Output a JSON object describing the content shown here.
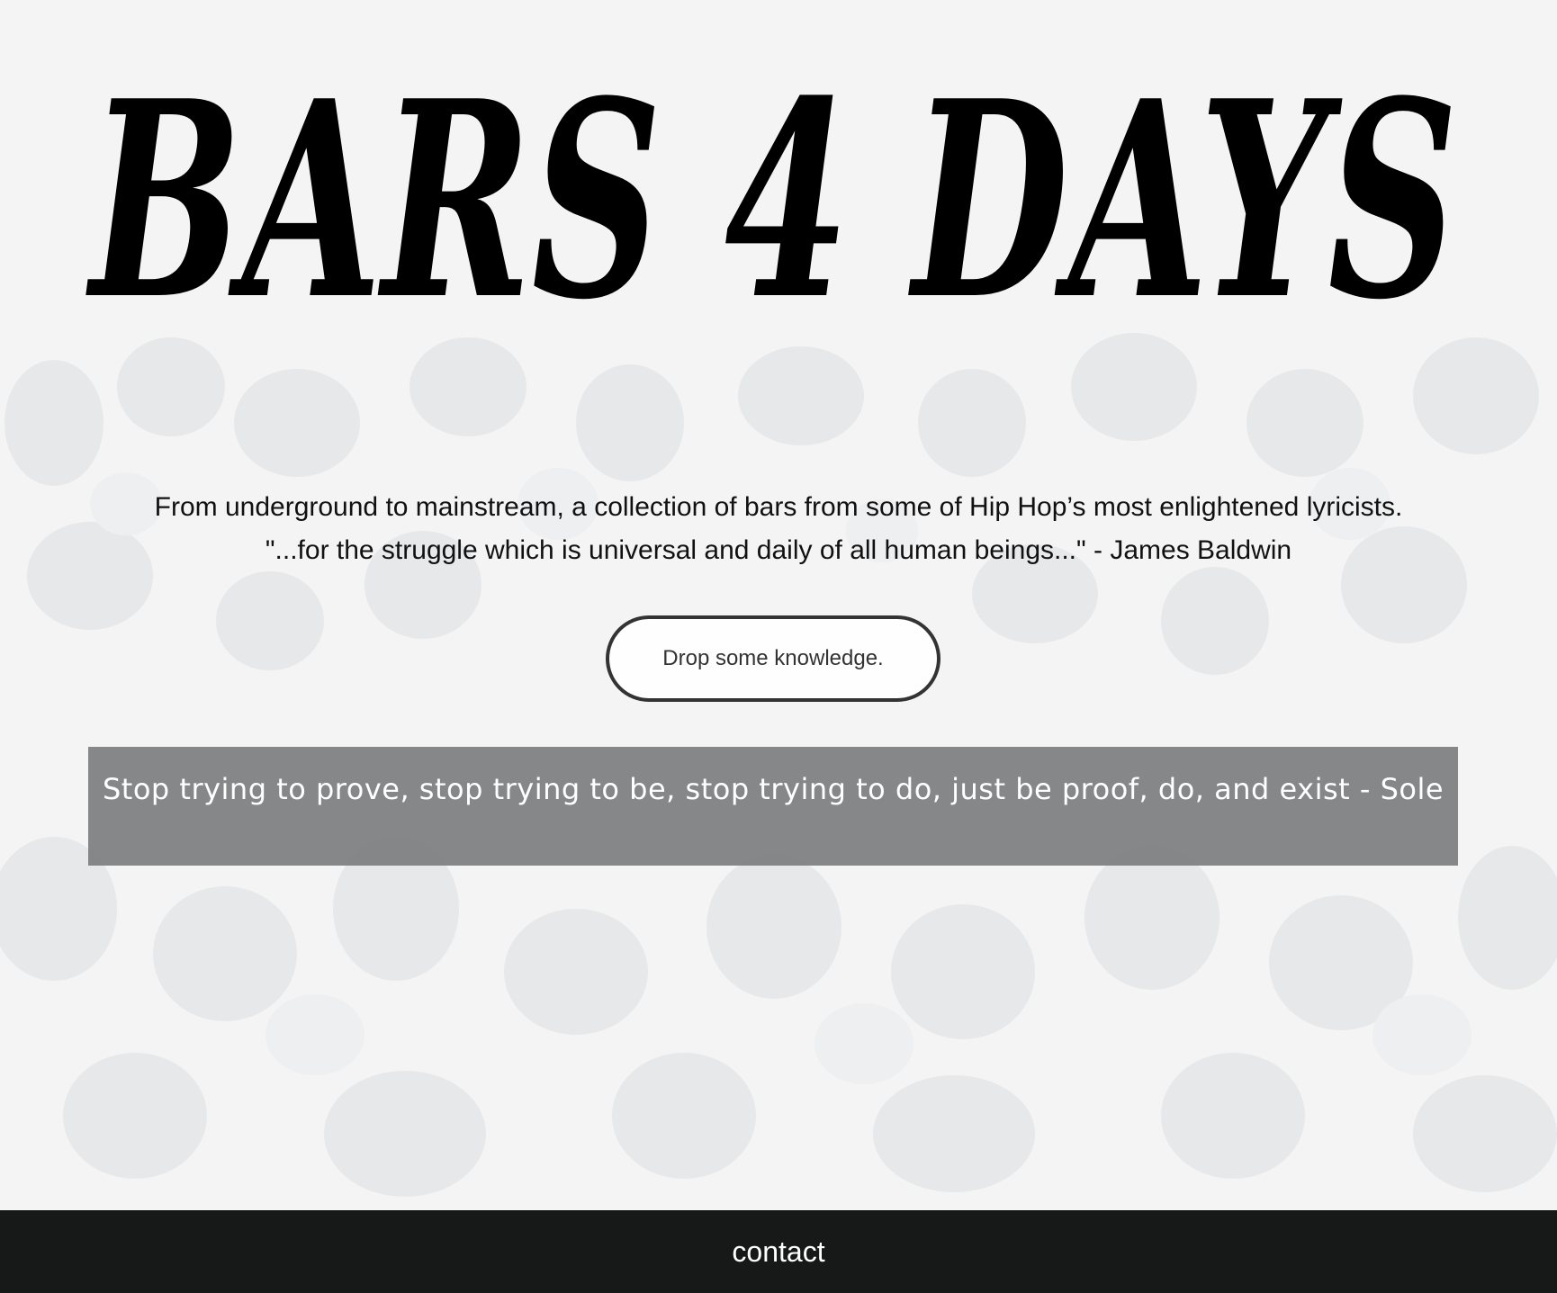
{
  "page": {
    "background_color": "#f3f3f3",
    "background_image": "crowd-photo-faded"
  },
  "header": {
    "title": "BARS 4 DAYS"
  },
  "intro": {
    "line1": "From underground to mainstream, a collection of bars from some of Hip Hop’s most enlightened lyricists.",
    "line2": "\"...for the struggle which is universal and daily of all human beings...\" - James Baldwin"
  },
  "cta": {
    "label": "Drop some knowledge."
  },
  "quote": {
    "text": "Stop trying to prove, stop trying to be, stop trying to do, just be proof, do, and exist - Sole",
    "panel_color": "#767879"
  },
  "footer": {
    "link_label": "contact",
    "background_color": "#171918"
  }
}
